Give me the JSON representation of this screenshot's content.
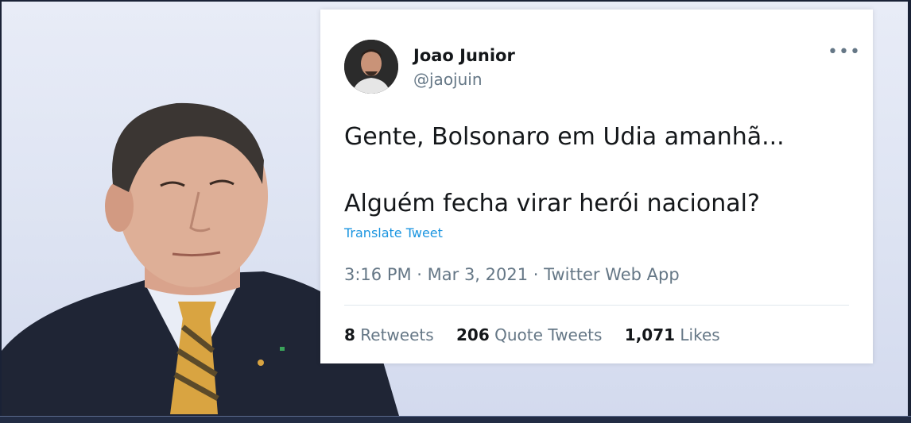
{
  "tweet": {
    "author_name": "Joao Junior",
    "author_handle": "@jaojuin",
    "more_icon": "•••",
    "line1": "Gente, Bolsonaro em Udia amanhã...",
    "line2": "Alguém fecha virar herói nacional?",
    "translate": "Translate Tweet",
    "meta": "3:16 PM · Mar 3, 2021 · Twitter Web App",
    "retweets_count": "8",
    "retweets_label": "Retweets",
    "quote_count": "206",
    "quote_label": "Quote Tweets",
    "likes_count": "1,071",
    "likes_label": "Likes"
  },
  "colors": {
    "text": "#14171a",
    "secondary": "#657786",
    "link": "#1b95e0"
  }
}
